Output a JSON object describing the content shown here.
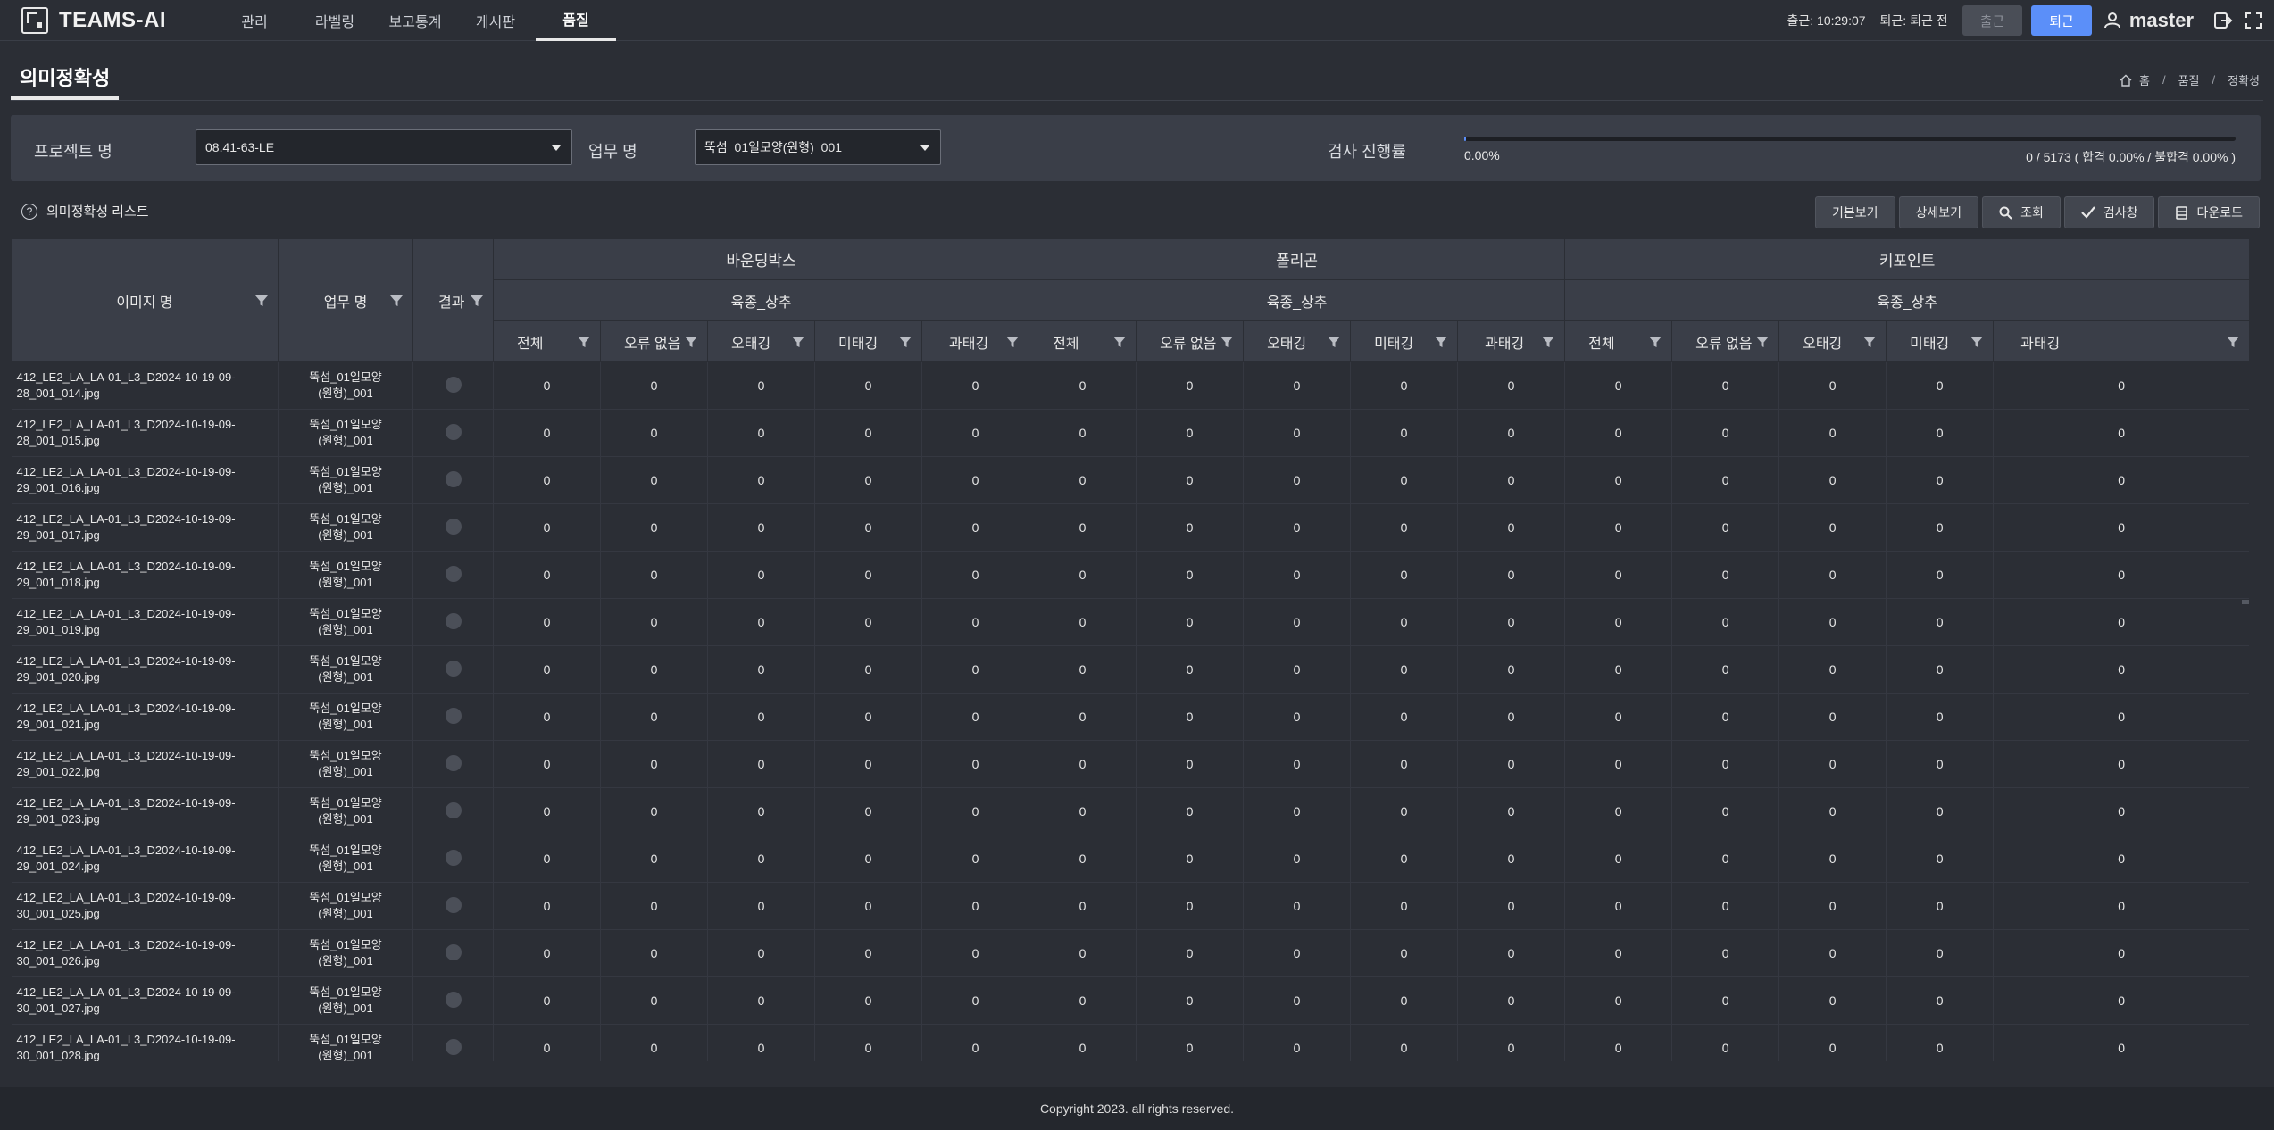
{
  "app": {
    "title": "TEAMS-AI"
  },
  "nav": [
    {
      "label": "관리",
      "active": false
    },
    {
      "label": "라벨링",
      "active": false
    },
    {
      "label": "보고통계",
      "active": false
    },
    {
      "label": "게시판",
      "active": false
    },
    {
      "label": "품질",
      "active": true
    }
  ],
  "header": {
    "clock_in": "출근: 10:29:07",
    "clock_out": "퇴근: 퇴근 전",
    "btn_in": "출근",
    "btn_out": "퇴근",
    "user": "master"
  },
  "page": {
    "title": "의미정확성",
    "breadcrumb": [
      "홈",
      "품질",
      "정확성"
    ]
  },
  "filter": {
    "project_label": "프로젝트 명",
    "project_value": "08.41-63-LE",
    "job_label": "업무 명",
    "job_value": "뚝섬_01일모양(원형)_001",
    "progress_label": "검사 진행률",
    "progress_fraction": 0.0,
    "progress_pct": "0.00%",
    "progress_stats": "0 / 5173 ( 합격 0.00% / 불합격 0.00% )"
  },
  "list": {
    "title": "의미정확성 리스트",
    "buttons": {
      "basic": "기본보기",
      "detail": "상세보기",
      "search": "조회",
      "inspect": "검사창",
      "download": "다운로드"
    }
  },
  "table": {
    "col_image": "이미지 명",
    "col_job": "업무 명",
    "col_result": "결과",
    "groups": [
      "바운딩박스",
      "폴리곤",
      "키포인트"
    ],
    "subgroup": "육종_상추",
    "leaf_cols": [
      "전체",
      "오류 없음",
      "오태깅",
      "미태깅",
      "과태깅"
    ],
    "rows": [
      {
        "name_l1": "412_LE2_LA_LA-01_L3_D2024-10-19-09-",
        "name_l2": "28_001_014.jpg",
        "job_l1": "뚝섬_01일모양",
        "job_l2": "(원형)_001",
        "values": [
          0,
          0,
          0,
          0,
          0,
          0,
          0,
          0,
          0,
          0,
          0,
          0,
          0,
          0,
          0
        ]
      },
      {
        "name_l1": "412_LE2_LA_LA-01_L3_D2024-10-19-09-",
        "name_l2": "28_001_015.jpg",
        "job_l1": "뚝섬_01일모양",
        "job_l2": "(원형)_001",
        "values": [
          0,
          0,
          0,
          0,
          0,
          0,
          0,
          0,
          0,
          0,
          0,
          0,
          0,
          0,
          0
        ]
      },
      {
        "name_l1": "412_LE2_LA_LA-01_L3_D2024-10-19-09-",
        "name_l2": "29_001_016.jpg",
        "job_l1": "뚝섬_01일모양",
        "job_l2": "(원형)_001",
        "values": [
          0,
          0,
          0,
          0,
          0,
          0,
          0,
          0,
          0,
          0,
          0,
          0,
          0,
          0,
          0
        ]
      },
      {
        "name_l1": "412_LE2_LA_LA-01_L3_D2024-10-19-09-",
        "name_l2": "29_001_017.jpg",
        "job_l1": "뚝섬_01일모양",
        "job_l2": "(원형)_001",
        "values": [
          0,
          0,
          0,
          0,
          0,
          0,
          0,
          0,
          0,
          0,
          0,
          0,
          0,
          0,
          0
        ]
      },
      {
        "name_l1": "412_LE2_LA_LA-01_L3_D2024-10-19-09-",
        "name_l2": "29_001_018.jpg",
        "job_l1": "뚝섬_01일모양",
        "job_l2": "(원형)_001",
        "values": [
          0,
          0,
          0,
          0,
          0,
          0,
          0,
          0,
          0,
          0,
          0,
          0,
          0,
          0,
          0
        ]
      },
      {
        "name_l1": "412_LE2_LA_LA-01_L3_D2024-10-19-09-",
        "name_l2": "29_001_019.jpg",
        "job_l1": "뚝섬_01일모양",
        "job_l2": "(원형)_001",
        "values": [
          0,
          0,
          0,
          0,
          0,
          0,
          0,
          0,
          0,
          0,
          0,
          0,
          0,
          0,
          0
        ]
      },
      {
        "name_l1": "412_LE2_LA_LA-01_L3_D2024-10-19-09-",
        "name_l2": "29_001_020.jpg",
        "job_l1": "뚝섬_01일모양",
        "job_l2": "(원형)_001",
        "values": [
          0,
          0,
          0,
          0,
          0,
          0,
          0,
          0,
          0,
          0,
          0,
          0,
          0,
          0,
          0
        ]
      },
      {
        "name_l1": "412_LE2_LA_LA-01_L3_D2024-10-19-09-",
        "name_l2": "29_001_021.jpg",
        "job_l1": "뚝섬_01일모양",
        "job_l2": "(원형)_001",
        "values": [
          0,
          0,
          0,
          0,
          0,
          0,
          0,
          0,
          0,
          0,
          0,
          0,
          0,
          0,
          0
        ]
      },
      {
        "name_l1": "412_LE2_LA_LA-01_L3_D2024-10-19-09-",
        "name_l2": "29_001_022.jpg",
        "job_l1": "뚝섬_01일모양",
        "job_l2": "(원형)_001",
        "values": [
          0,
          0,
          0,
          0,
          0,
          0,
          0,
          0,
          0,
          0,
          0,
          0,
          0,
          0,
          0
        ]
      },
      {
        "name_l1": "412_LE2_LA_LA-01_L3_D2024-10-19-09-",
        "name_l2": "29_001_023.jpg",
        "job_l1": "뚝섬_01일모양",
        "job_l2": "(원형)_001",
        "values": [
          0,
          0,
          0,
          0,
          0,
          0,
          0,
          0,
          0,
          0,
          0,
          0,
          0,
          0,
          0
        ]
      },
      {
        "name_l1": "412_LE2_LA_LA-01_L3_D2024-10-19-09-",
        "name_l2": "29_001_024.jpg",
        "job_l1": "뚝섬_01일모양",
        "job_l2": "(원형)_001",
        "values": [
          0,
          0,
          0,
          0,
          0,
          0,
          0,
          0,
          0,
          0,
          0,
          0,
          0,
          0,
          0
        ]
      },
      {
        "name_l1": "412_LE2_LA_LA-01_L3_D2024-10-19-09-",
        "name_l2": "30_001_025.jpg",
        "job_l1": "뚝섬_01일모양",
        "job_l2": "(원형)_001",
        "values": [
          0,
          0,
          0,
          0,
          0,
          0,
          0,
          0,
          0,
          0,
          0,
          0,
          0,
          0,
          0
        ]
      },
      {
        "name_l1": "412_LE2_LA_LA-01_L3_D2024-10-19-09-",
        "name_l2": "30_001_026.jpg",
        "job_l1": "뚝섬_01일모양",
        "job_l2": "(원형)_001",
        "values": [
          0,
          0,
          0,
          0,
          0,
          0,
          0,
          0,
          0,
          0,
          0,
          0,
          0,
          0,
          0
        ]
      },
      {
        "name_l1": "412_LE2_LA_LA-01_L3_D2024-10-19-09-",
        "name_l2": "30_001_027.jpg",
        "job_l1": "뚝섬_01일모양",
        "job_l2": "(원형)_001",
        "values": [
          0,
          0,
          0,
          0,
          0,
          0,
          0,
          0,
          0,
          0,
          0,
          0,
          0,
          0,
          0
        ]
      },
      {
        "name_l1": "412_LE2_LA_LA-01_L3_D2024-10-19-09-",
        "name_l2": "30_001_028.jpg",
        "job_l1": "뚝섬_01일모양",
        "job_l2": "(원형)_001",
        "values": [
          0,
          0,
          0,
          0,
          0,
          0,
          0,
          0,
          0,
          0,
          0,
          0,
          0,
          0,
          0
        ]
      }
    ]
  },
  "footer": {
    "copyright": "Copyright 2023. all rights reserved."
  }
}
